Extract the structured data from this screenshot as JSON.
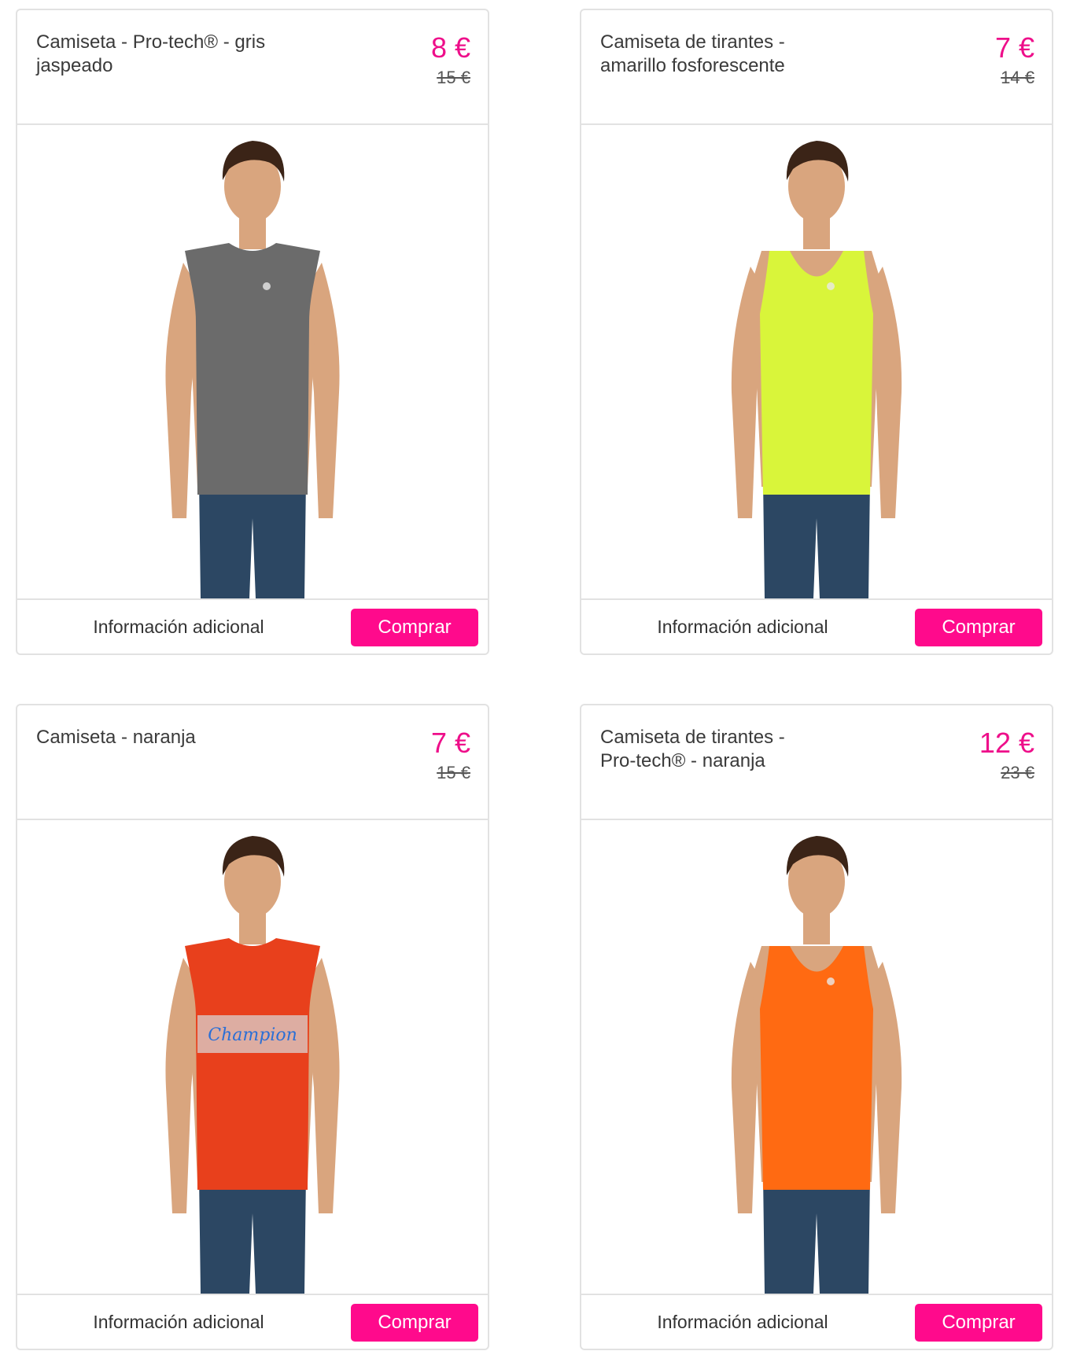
{
  "products": [
    {
      "title": "Camiseta - Pro-tech® - gris\njaspeado",
      "price": "8 €",
      "old_price": "15 €",
      "info_label": "Información adicional",
      "buy_label": "Comprar",
      "shirt_style": "sleeveless",
      "shirt_color": "#6b6b6b",
      "print_text": ""
    },
    {
      "title": "Camiseta de tirantes -\namarillo fosforescente",
      "price": "7 €",
      "old_price": "14 €",
      "info_label": "Información adicional",
      "buy_label": "Comprar",
      "shirt_style": "tank",
      "shirt_color": "#d9f53a",
      "print_text": ""
    },
    {
      "title": "Camiseta - naranja",
      "price": "7 €",
      "old_price": "15 €",
      "info_label": "Información adicional",
      "buy_label": "Comprar",
      "shirt_style": "sleeveless",
      "shirt_color": "#e8401c",
      "print_text": "Champion"
    },
    {
      "title": "Camiseta de tirantes -\nPro-tech® - naranja",
      "price": "12 €",
      "old_price": "23 €",
      "info_label": "Información adicional",
      "buy_label": "Comprar",
      "shirt_style": "tank",
      "shirt_color": "#ff6a12",
      "print_text": ""
    }
  ],
  "colors": {
    "accent": "#ff0a8c",
    "price": "#ee0f8a",
    "border": "#e2e2e2",
    "skin": "#d9a57e",
    "hair": "#3b2417",
    "jeans": "#2c4763"
  }
}
